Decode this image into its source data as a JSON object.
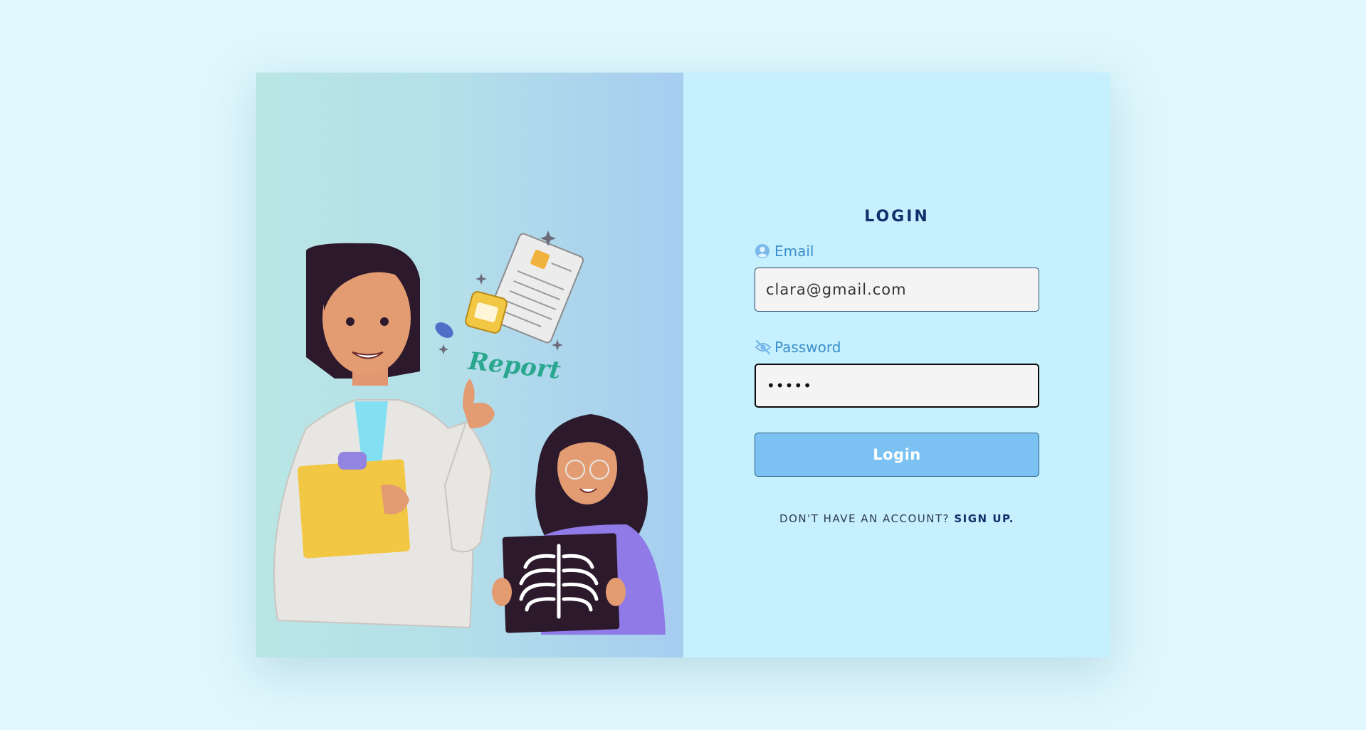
{
  "login": {
    "title": "LOGIN",
    "email_label": "Email",
    "email_value": "clara@gmail.com",
    "email_icon": "user-circle-icon",
    "password_label": "Password",
    "password_value": "•••••",
    "password_icon": "eye-slash-icon",
    "submit_label": "Login",
    "signup_prompt": "DON'T HAVE AN ACCOUNT?",
    "signup_link": "SIGN UP."
  },
  "illustration": {
    "report_text": "Report"
  },
  "colors": {
    "page_bg": "#dff7fd",
    "panel_bg": "#c6f0fd",
    "title": "#132f6b",
    "label": "#3a8fcb",
    "button": "#7bc2f3"
  }
}
